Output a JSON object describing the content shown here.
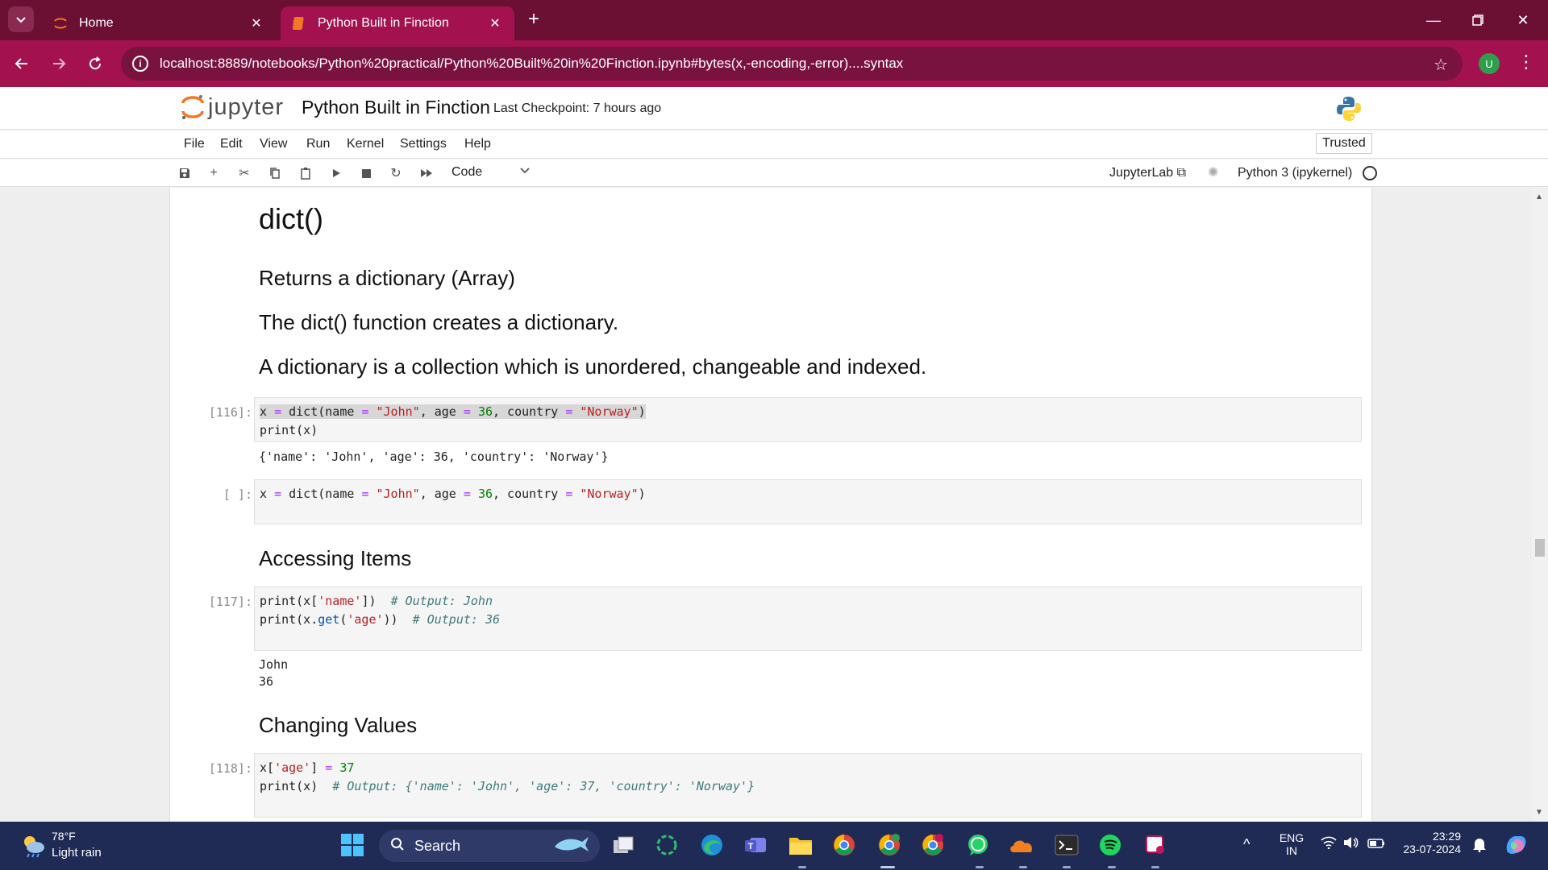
{
  "browser": {
    "tabs": [
      {
        "label": "Home",
        "active": false
      },
      {
        "label": "Python Built in Finction",
        "active": true
      }
    ],
    "url": "localhost:8889/notebooks/Python%20practical/Python%20Built%20in%20Finction.ipynb#bytes(x,-encoding,-error)....syntax",
    "profile_initial": "U",
    "accent_color": "#a3124f"
  },
  "jupyter": {
    "logo_text": "jupyter",
    "notebook_title": "Python Built in Finction",
    "checkpoint": "Last Checkpoint: 7 hours ago",
    "menu": [
      "File",
      "Edit",
      "View",
      "Run",
      "Kernel",
      "Settings",
      "Help"
    ],
    "trusted": "Trusted",
    "cell_type": "Code",
    "jupyterlab_label": "JupyterLab",
    "kernel_name": "Python 3 (ipykernel)"
  },
  "notebook": {
    "h_dict": "dict()",
    "p_returns": "Returns a dictionary (Array)",
    "p_creates": "The dict() function creates a dictionary.",
    "p_collection": "A dictionary is a collection which is unordered, changeable and indexed.",
    "cell116_prompt": "[116]:",
    "cell116_line2": "print(x)",
    "cell116_output": "{'name': 'John', 'age': 36, 'country': 'Norway'}",
    "cell_empty_prompt": "[ ]:",
    "h_accessing": "Accessing Items",
    "cell117_prompt": "[117]:",
    "cell117_out1": "John",
    "cell117_out2": "36",
    "h_changing": "Changing Values",
    "cell118_prompt": "[118]:"
  },
  "taskbar": {
    "weather_temp": "78°F",
    "weather_desc": "Light rain",
    "search_label": "Search",
    "lang_line1": "ENG",
    "lang_line2": "IN",
    "time": "23:29",
    "date": "23-07-2024"
  }
}
